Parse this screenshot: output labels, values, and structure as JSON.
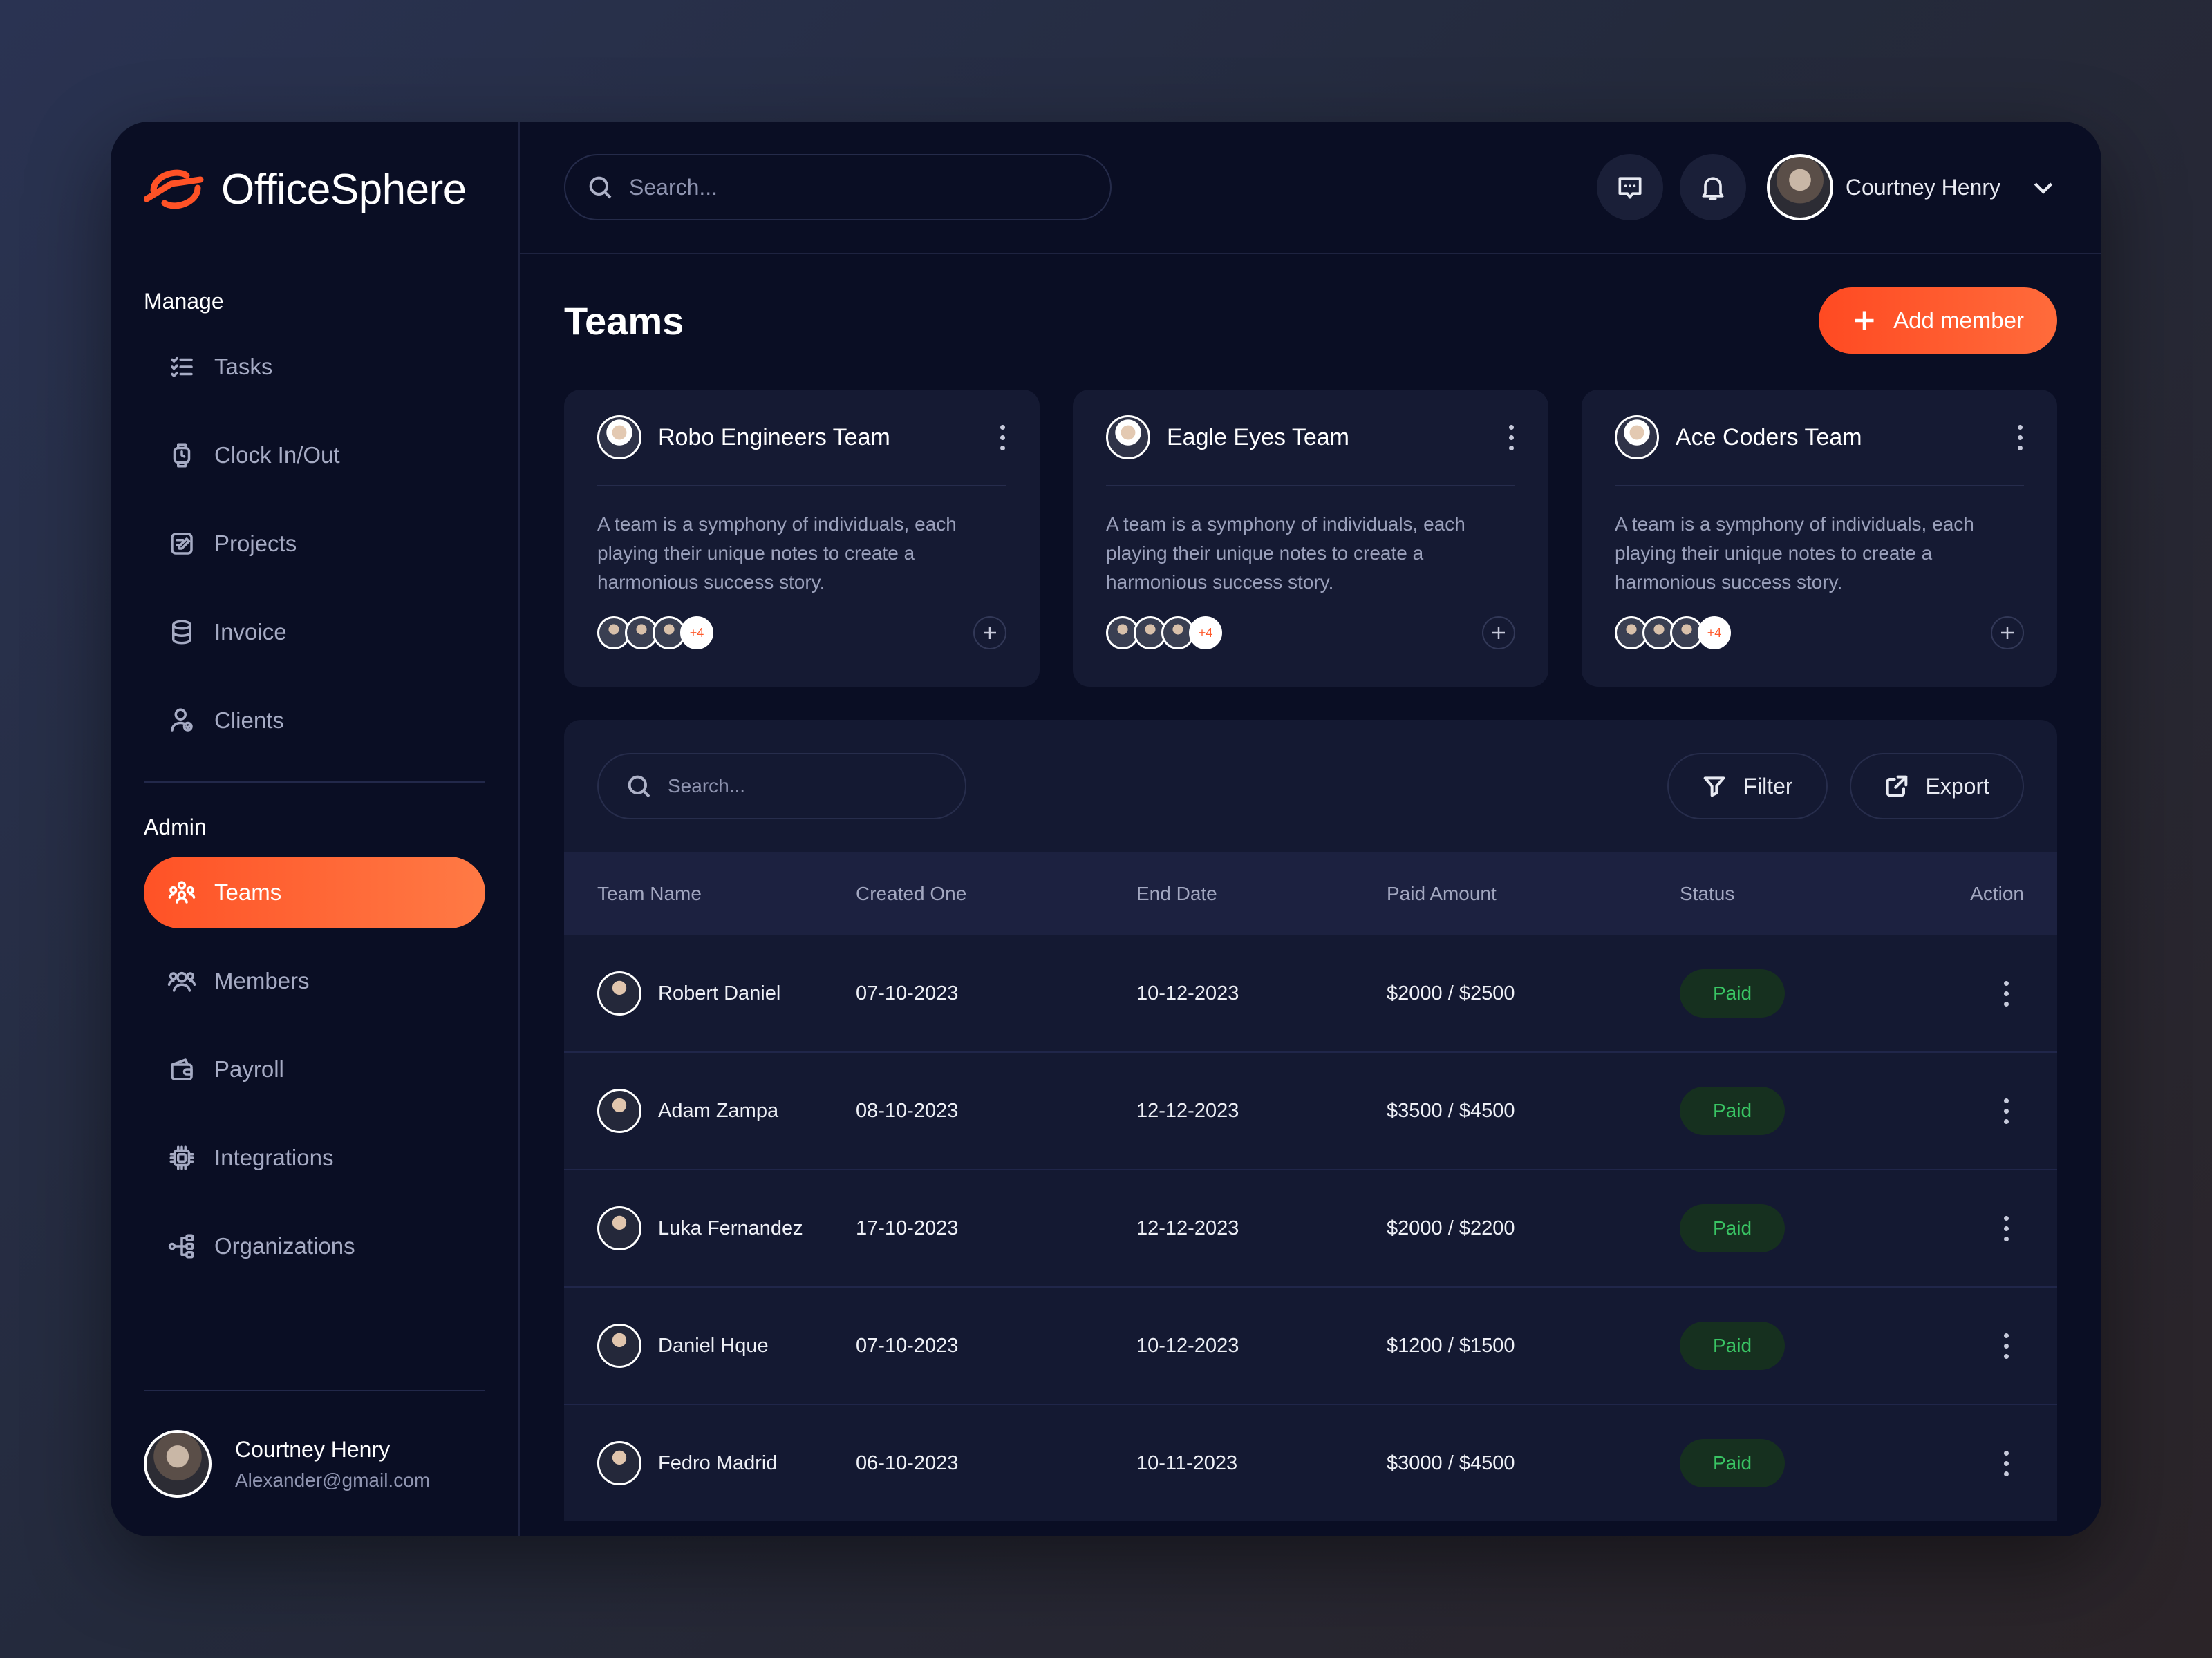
{
  "brand": {
    "name": "OfficeSphere",
    "accent": "#ff5226"
  },
  "sidebar": {
    "manage_title": "Manage",
    "manage_items": [
      {
        "label": "Tasks",
        "icon": "tasks-icon"
      },
      {
        "label": "Clock In/Out",
        "icon": "watch-icon"
      },
      {
        "label": "Projects",
        "icon": "projects-icon"
      },
      {
        "label": "Invoice",
        "icon": "database-icon"
      },
      {
        "label": "Clients",
        "icon": "clients-icon"
      }
    ],
    "admin_title": "Admin",
    "admin_items": [
      {
        "label": "Teams",
        "icon": "teams-icon",
        "active": true
      },
      {
        "label": "Members",
        "icon": "members-icon"
      },
      {
        "label": "Payroll",
        "icon": "wallet-icon"
      },
      {
        "label": "Integrations",
        "icon": "chip-icon"
      },
      {
        "label": "Organizations",
        "icon": "hierarchy-icon"
      }
    ],
    "profile": {
      "name": "Courtney Henry",
      "email": "Alexander@gmail.com"
    }
  },
  "topbar": {
    "search_placeholder": "Search...",
    "user_name": "Courtney Henry"
  },
  "page": {
    "title": "Teams",
    "add_button": "Add member"
  },
  "teams": [
    {
      "name": "Robo Engineers Team",
      "description": "A team is a symphony of individuals, each playing their unique notes to create a harmonious success story.",
      "more": "+4"
    },
    {
      "name": "Eagle Eyes Team",
      "description": "A team is a symphony of individuals, each playing their unique notes to create a harmonious success story.",
      "more": "+4"
    },
    {
      "name": "Ace Coders Team",
      "description": "A team is a symphony of individuals, each playing their unique notes to create a harmonious success story.",
      "more": "+4"
    }
  ],
  "table": {
    "search_placeholder": "Search...",
    "filter_label": "Filter",
    "export_label": "Export",
    "columns": [
      "Team Name",
      "Created One",
      "End Date",
      "Paid Amount",
      "Status",
      "Action"
    ],
    "rows": [
      {
        "name": "Robert Daniel",
        "created": "07-10-2023",
        "end": "10-12-2023",
        "paid": "$2000 / $2500",
        "status": "Paid"
      },
      {
        "name": "Adam Zampa",
        "created": "08-10-2023",
        "end": "12-12-2023",
        "paid": "$3500 / $4500",
        "status": "Paid"
      },
      {
        "name": "Luka Fernandez",
        "created": "17-10-2023",
        "end": "12-12-2023",
        "paid": "$2000 / $2200",
        "status": "Paid"
      },
      {
        "name": "Daniel Hque",
        "created": "07-10-2023",
        "end": "10-12-2023",
        "paid": "$1200 / $1500",
        "status": "Paid"
      },
      {
        "name": "Fedro Madrid",
        "created": "06-10-2023",
        "end": "10-11-2023",
        "paid": "$3000 / $4500",
        "status": "Paid"
      }
    ]
  }
}
